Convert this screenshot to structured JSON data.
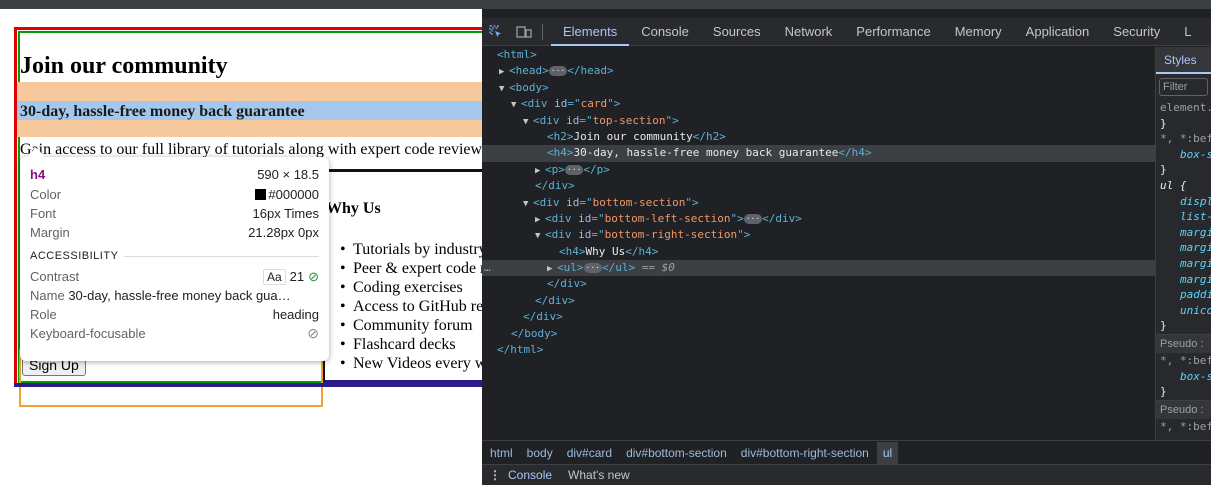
{
  "page": {
    "heading": "Join our community",
    "guarantee": "30-day, hassle-free money back guarantee",
    "paragraph": "Gain access to our full library of tutorials along with expert code reviews. Perfect for any developers who are serious about honing their skills.",
    "why_us": "Why Us",
    "features": [
      "Tutorials by industry experts",
      "Peer & expert code review",
      "Coding exercises",
      "Access to GitHub repos",
      "Community forum",
      "Flashcard decks",
      "New Videos every week"
    ],
    "signup_button": "Sign Up"
  },
  "tooltip": {
    "tag": "h4",
    "dimensions": "590 × 18.5",
    "rows": [
      {
        "label": "Color",
        "value": "#000000"
      },
      {
        "label": "Font",
        "value": "16px Times"
      },
      {
        "label": "Margin",
        "value": "21.28px 0px"
      }
    ],
    "section": "ACCESSIBILITY",
    "contrast_label": "Contrast",
    "contrast_badge": "Aa",
    "contrast_value": "21",
    "name_label": "Name",
    "name_value": "30-day, hassle-free money back gua…",
    "role_label": "Role",
    "role_value": "heading",
    "keyboard_label": "Keyboard-focusable",
    "swatch_color": "#000000"
  },
  "devtools": {
    "tabs": [
      "Elements",
      "Console",
      "Sources",
      "Network",
      "Performance",
      "Memory",
      "Application",
      "Security",
      "L"
    ],
    "active_tab": "Elements",
    "dom": {
      "html_open": "<html>",
      "head": "<head>",
      "head_close": "</head>",
      "body_open": "<body>",
      "card_id": "card",
      "top_section_id": "top-section",
      "h2_text": "Join our community",
      "h4_text": "30-day, hassle-free money back guarantee",
      "bottom_section_id": "bottom-section",
      "bottom_left_id": "bottom-left-section",
      "bottom_right_id": "bottom-right-section",
      "h4_why": "Why Us",
      "selected_marker": "== $0",
      "body_close": "</body>",
      "html_close": "</html>"
    },
    "styles": {
      "tab": "Styles",
      "filter": "Filter",
      "lines": [
        "element.",
        "}",
        "*, *:bef",
        "box-s",
        "}",
        "ul {",
        "displ",
        "list-",
        "margi",
        "margi",
        "margi",
        "margi",
        "paddi",
        "unico",
        "}",
        "Pseudo :",
        "*, *:bef",
        "box-s",
        "}",
        "Pseudo :",
        "*, *:bef"
      ]
    },
    "breadcrumbs": [
      "html",
      "body",
      "div#card",
      "div#bottom-section",
      "div#bottom-right-section",
      "ul"
    ],
    "drawer_tabs": [
      "Console",
      "What's new"
    ]
  },
  "colors": {
    "tag": "#5db0d7",
    "attr_value": "#f29766",
    "accent": "#a8c7fa"
  }
}
